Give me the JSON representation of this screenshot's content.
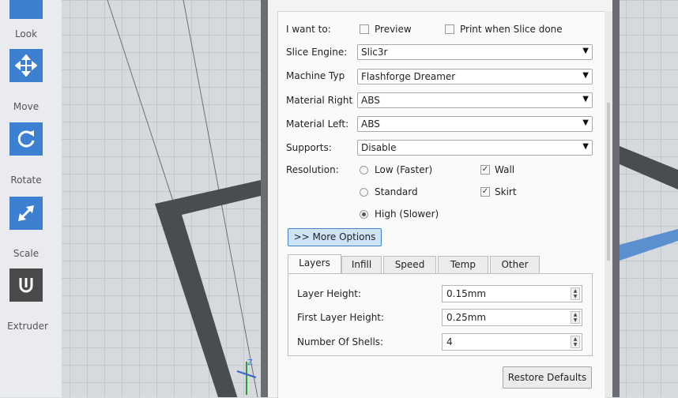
{
  "toolbar": {
    "tools": [
      {
        "label": "Look",
        "icon": "eye-icon"
      },
      {
        "label": "Move",
        "icon": "move-arrows-icon"
      },
      {
        "label": "Rotate",
        "icon": "rotate-icon"
      },
      {
        "label": "Scale",
        "icon": "scale-arrow-icon"
      },
      {
        "label": "Extruder",
        "icon": "extruder-icon"
      }
    ]
  },
  "settings": {
    "i_want_to_label": "I want to:",
    "preview_label": "Preview",
    "print_when_done_label": "Print when Slice done",
    "slice_engine_label": "Slice Engine:",
    "slice_engine_value": "Slic3r",
    "machine_type_label": "Machine Typ",
    "machine_type_value": "Flashforge Dreamer",
    "material_right_label": "Material Right",
    "material_right_value": "ABS",
    "material_left_label": "Material Left:",
    "material_left_value": "ABS",
    "supports_label": "Supports:",
    "supports_value": "Disable",
    "resolution_label": "Resolution:",
    "res_low": "Low (Faster)",
    "res_standard": "Standard",
    "res_high": "High (Slower)",
    "wall_label": "Wall",
    "skirt_label": "Skirt",
    "more_options": ">> More Options"
  },
  "tabs": [
    "Layers",
    "Infill",
    "Speed",
    "Temp",
    "Other"
  ],
  "layers": {
    "layer_height_label": "Layer Height:",
    "layer_height_value": "0.15mm",
    "first_layer_height_label": "First Layer Height:",
    "first_layer_height_value": "0.25mm",
    "shells_label": "Number Of Shells:",
    "shells_value": "4"
  },
  "restore_defaults": "Restore Defaults",
  "colors": {
    "accent": "#3d7fd1",
    "frame": "#6a6e73"
  }
}
